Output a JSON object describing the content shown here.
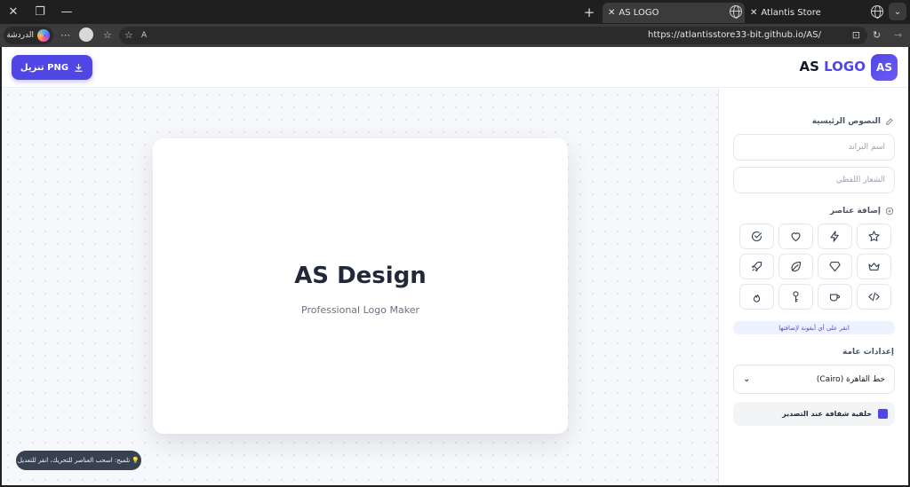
{
  "browser": {
    "tabs": [
      {
        "title": "AS LOGO",
        "active": true
      },
      {
        "title": "Atlantis Store",
        "active": false
      }
    ],
    "url": "https://atlantisstore33-bit.github.io/AS/",
    "profile_label": "الدردشة",
    "read_aloud_label": "A"
  },
  "header": {
    "badge_text": "AS",
    "logo_prefix": "AS ",
    "logo_accent": "LOGO",
    "download_label": "تنزيل PNG"
  },
  "canvas": {
    "brand_name": "AS Design",
    "slogan": "Professional Logo Maker",
    "tip": "💡 تلميح: اسحب العناصر للتحريك، انقر للتعديل"
  },
  "sidebar": {
    "main_texts_title": "النصوص الرئيسية",
    "brand_placeholder": "اسم البراند",
    "slogan_placeholder": "الشعار اللفظي",
    "add_elements_title": "إضافة عناصر",
    "icons": [
      "star-icon",
      "bolt-icon",
      "heart-icon",
      "check-circle-icon",
      "crown-icon",
      "gem-icon",
      "leaf-icon",
      "rocket-icon",
      "code-icon",
      "coffee-icon",
      "key-icon",
      "fire-icon"
    ],
    "hint": "انقر على أي أيقونة لإضافتها",
    "general_settings_title": "إعدادات عامة",
    "font_value": "خط القاهرة (Cairo)",
    "transparent_bg_label": "خلفية شفافة عند التصدير"
  },
  "colors": {
    "accent": "#4f46e5",
    "text_dark": "#1f2937"
  }
}
